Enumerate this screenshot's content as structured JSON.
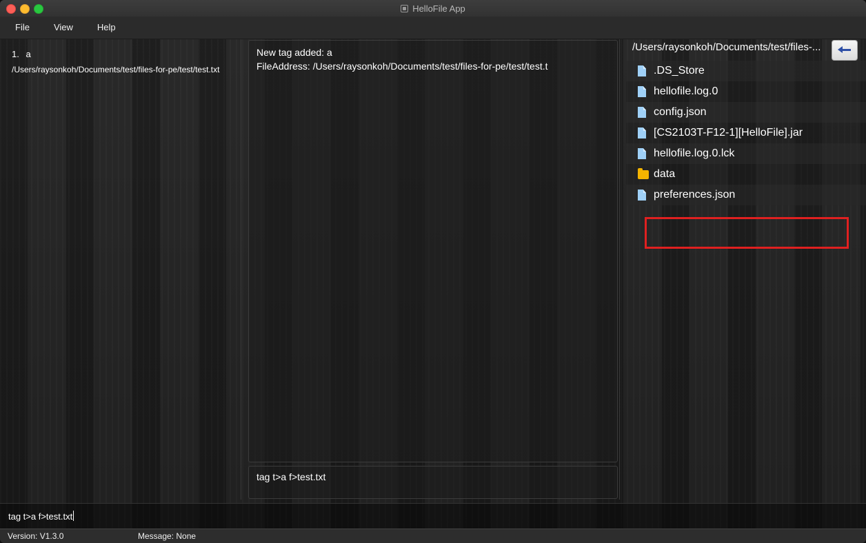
{
  "window": {
    "title": "HelloFile App"
  },
  "menu": {
    "items": [
      "File",
      "View",
      "Help"
    ]
  },
  "tags": [
    {
      "index_label": "1.",
      "name": "a",
      "path": "/Users/raysonkoh/Documents/test/files-for-pe/test/test.txt"
    }
  ],
  "result": {
    "lines": [
      "New tag added: a",
      "FileAddress: /Users/raysonkoh/Documents/test/files-for-pe/test/test.t"
    ]
  },
  "echo": {
    "text": "tag t>a f>test.txt"
  },
  "browser": {
    "current_path": "/Users/raysonkoh/Documents/test/files-...",
    "back_icon": "arrow-left-icon",
    "files": [
      {
        "name": ".DS_Store",
        "type": "file"
      },
      {
        "name": "hellofile.log.0",
        "type": "file"
      },
      {
        "name": "config.json",
        "type": "file"
      },
      {
        "name": "[CS2103T-F12-1][HelloFile].jar",
        "type": "file"
      },
      {
        "name": "hellofile.log.0.lck",
        "type": "file"
      },
      {
        "name": "data",
        "type": "folder"
      },
      {
        "name": "preferences.json",
        "type": "file"
      }
    ]
  },
  "command": {
    "value": "tag t>a f>test.txt"
  },
  "status": {
    "version": "Version:  V1.3.0",
    "message": "Message:  None"
  },
  "colors": {
    "highlight": "#e02020",
    "file_icon": "#9fd0f7",
    "folder_icon": "#f4b400",
    "back_arrow": "#2e4fa6"
  }
}
